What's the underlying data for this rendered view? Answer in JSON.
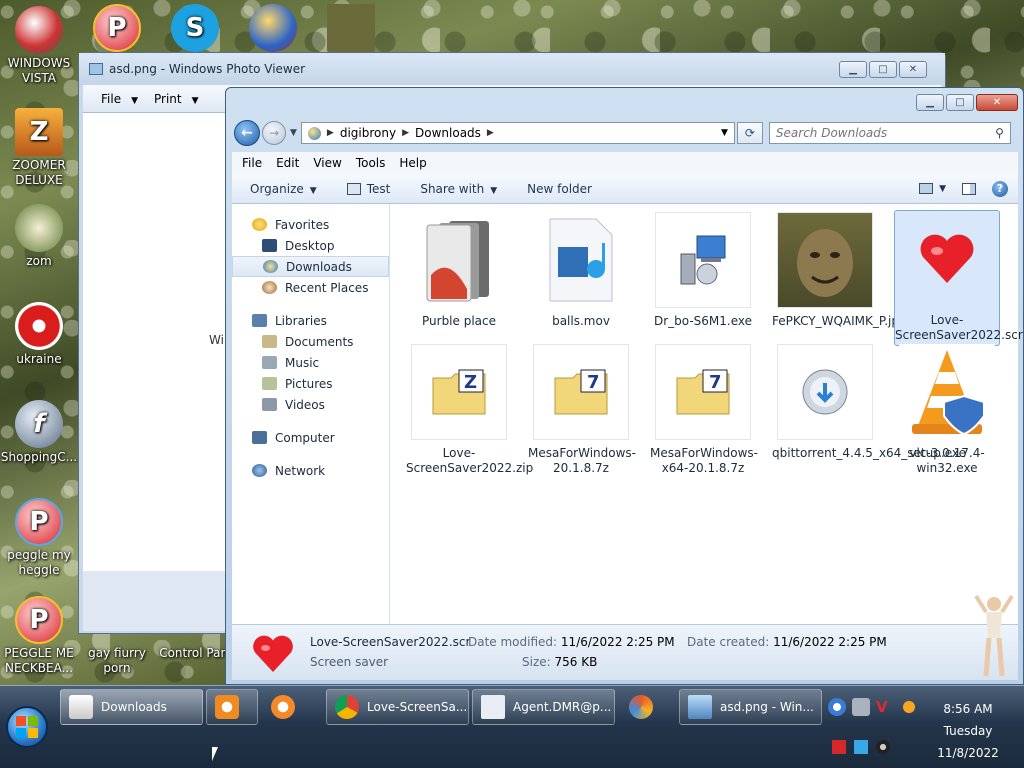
{
  "desktop": {
    "icons": [
      {
        "label": "WINDOWS VISTA"
      },
      {
        "label": "ZOOMER DELUXE"
      },
      {
        "label": "zom"
      },
      {
        "label": "ukraine"
      },
      {
        "label": "ShoppingC..."
      },
      {
        "label": "peggle my heggle"
      },
      {
        "label": "PEGGLE ME NECKBEA..."
      },
      {
        "label": "gay fiurry porn"
      },
      {
        "label": "Control Panel"
      }
    ]
  },
  "photo_viewer": {
    "title": "asd.png - Windows Photo Viewer",
    "menu": {
      "file": "File",
      "print": "Print"
    },
    "partial_text": "Wi"
  },
  "explorer": {
    "address": {
      "segments": [
        "digibrony",
        "Downloads"
      ]
    },
    "search": {
      "placeholder": "Search Downloads"
    },
    "menu": [
      "File",
      "Edit",
      "View",
      "Tools",
      "Help"
    ],
    "commands": {
      "organize": "Organize",
      "test": "Test",
      "share_with": "Share with",
      "new_folder": "New folder"
    },
    "nav": {
      "favorites": "Favorites",
      "desktop": "Desktop",
      "downloads": "Downloads",
      "recent": "Recent Places",
      "libraries": "Libraries",
      "documents": "Documents",
      "music": "Music",
      "pictures": "Pictures",
      "videos": "Videos",
      "computer": "Computer",
      "network": "Network"
    },
    "files": [
      {
        "name": "Purble place",
        "icon": "folder-icon"
      },
      {
        "name": "balls.mov",
        "icon": "video-file-icon"
      },
      {
        "name": "Dr_bo-S6M1.exe",
        "icon": "installer-icon"
      },
      {
        "name": "FePKCY_WQAIMK_P.jpg",
        "icon": "image-thumbnail"
      },
      {
        "name": "Love-ScreenSaver2022.scr",
        "icon": "heart-icon",
        "selected": true
      },
      {
        "name": "Love-ScreenSaver2022.zip",
        "icon": "zip-folder-icon"
      },
      {
        "name": "MesaForWindows-20.1.8.7z",
        "icon": "7z-folder-icon"
      },
      {
        "name": "MesaForWindows-x64-20.1.8.7z",
        "icon": "7z-folder-icon"
      },
      {
        "name": "qbittorrent_4.4.5_x64_setup.exe",
        "icon": "nsis-installer-icon"
      },
      {
        "name": "vlc-3.0.17.4-win32.exe",
        "icon": "vlc-cone-icon"
      }
    ],
    "details": {
      "name": "Love-ScreenSaver2022.scr",
      "type": "Screen saver",
      "modified_label": "Date modified:",
      "modified": "11/6/2022 2:25 PM",
      "created_label": "Date created:",
      "created": "11/6/2022 2:25 PM",
      "size_label": "Size:",
      "size": "756 KB"
    }
  },
  "taskbar": {
    "buttons": [
      {
        "label": "Downloads"
      },
      {
        "label": "Love-ScreenSa..."
      },
      {
        "label": "Agent.DMR@p..."
      },
      {
        "label": "asd.png - Win..."
      }
    ],
    "clock": {
      "time": "8:56 AM",
      "day": "Tuesday",
      "date": "11/8/2022"
    }
  }
}
